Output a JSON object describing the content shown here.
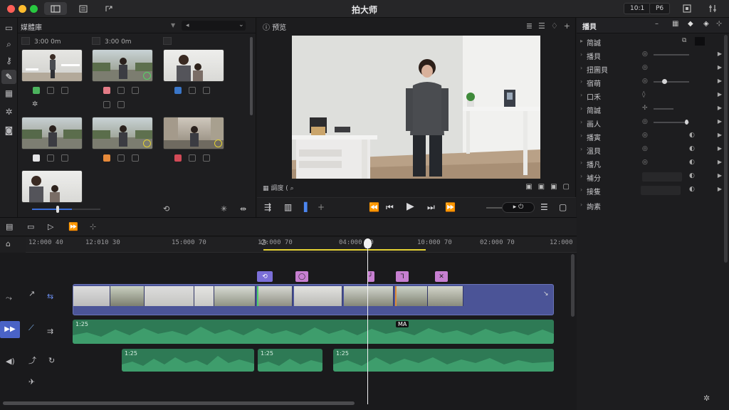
{
  "app": {
    "title": "拍大师"
  },
  "titlebar": {
    "pill_left": "10:1",
    "pill_right": "P6"
  },
  "media": {
    "panel_title": "媒體庫",
    "col_heads": [
      "3:00 0m",
      "3:00 0m"
    ],
    "search_placeholder": ""
  },
  "viewer": {
    "panel_title": "预览",
    "sub_label": "調度 ("
  },
  "inspector": {
    "tab_title": "播貝",
    "rows": [
      {
        "name": "简誠"
      },
      {
        "name": "播貝"
      },
      {
        "name": "扭圖貝"
      },
      {
        "name": "宿萌"
      },
      {
        "name": "口禾"
      },
      {
        "name": "简誠"
      },
      {
        "name": "画人"
      },
      {
        "name": "播寅"
      },
      {
        "name": "溫貝"
      },
      {
        "name": "播凡"
      },
      {
        "name": "補分"
      },
      {
        "name": "接隻"
      },
      {
        "name": "詢素"
      }
    ]
  },
  "timeline": {
    "ruler_labels": [
      "12:000 40",
      "12:010 30",
      "15:000 70",
      "12:000 70",
      "04:000 30",
      "10:000 70",
      "02:000 70",
      "12:000"
    ],
    "audio_top_label": "1:25",
    "audio_clip_labels": [
      "1:25",
      "1:25",
      "1:25"
    ],
    "center_badge": "MA"
  },
  "colors": {
    "accent_yellow": "#e4d233",
    "marker_purple": "#7b6fd8",
    "marker_pink": "#c77fd1",
    "clip_blue": "#4b5497",
    "audio_green": "#2e7a55"
  }
}
